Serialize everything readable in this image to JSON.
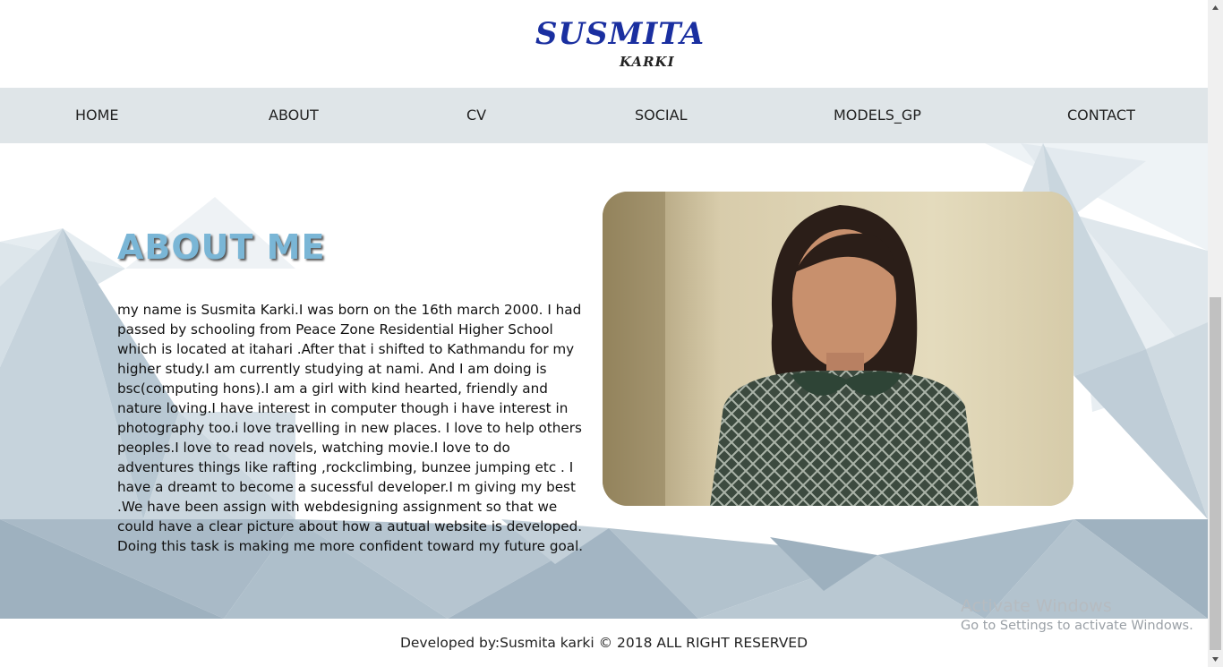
{
  "logo": {
    "main": "SUSMITA",
    "sub": "KARKI"
  },
  "nav": {
    "items": [
      {
        "label": "HOME"
      },
      {
        "label": "ABOUT"
      },
      {
        "label": "CV"
      },
      {
        "label": "SOCIAL"
      },
      {
        "label": "MODELS_GP"
      },
      {
        "label": "CONTACT"
      }
    ]
  },
  "about": {
    "title": "ABOUT ME",
    "text": "my name is Susmita Karki.I was born on the 16th march 2000. I had passed by schooling from Peace Zone Residential Higher School which is located at itahari .After that i shifted to Kathmandu for my higher study.I am currently studying at nami. And I am doing is bsc(computing hons).I am a girl with kind hearted, friendly and nature loving.I have interest in computer though i have interest in photography too.i love travelling in new places. I love to help others peoples.I love to read novels, watching movie.I love to do adventures things like rafting ,rockclimbing, bunzee jumping etc . I have a dreamt to become a sucessful developer.I m giving my best .We have been assign with webdesigning assignment so that we could have a clear picture about how a autual website is developed. Doing this task is making me more confident toward my future goal."
  },
  "footer": {
    "text": "Developed by:Susmita karki © 2018 ALL RIGHT RESERVED"
  },
  "watermark": {
    "title": "Activate Windows",
    "subtitle": "Go to Settings to activate Windows."
  },
  "colors": {
    "nav_bg": "#dfe5e8",
    "title": "#7ab6d6",
    "logo": "#1a2fa0"
  }
}
